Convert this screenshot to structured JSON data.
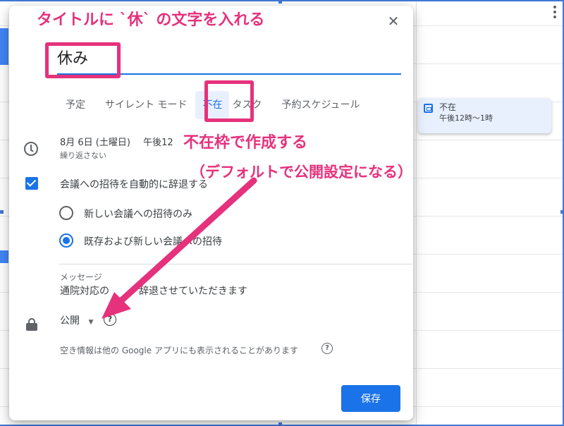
{
  "annotations": {
    "title_note": "タイトルに `休` の文字を入れる",
    "ooo_note_line1": "不在枠で作成する",
    "ooo_note_line2": "（デフォルトで公開設定になる）",
    "color": "#e6317c"
  },
  "dialog": {
    "title_value": "休み",
    "tabs": [
      {
        "label": "予定",
        "active": false
      },
      {
        "label": "サイレント モード",
        "active": false
      },
      {
        "label": "不在",
        "active": true
      },
      {
        "label": "タスク",
        "active": false
      },
      {
        "label": "予約スケジュール",
        "active": false
      }
    ],
    "datetime": {
      "date": "8月 6日 (土曜日)",
      "time": "午後12",
      "recurrence": "繰り返さない"
    },
    "auto_decline": {
      "label": "会議への招待を自動的に辞退する",
      "checked": true,
      "options": [
        {
          "label": "新しい会議への招待のみ",
          "selected": false
        },
        {
          "label": "既存および新しい会議への招待",
          "selected": true
        }
      ]
    },
    "message": {
      "label": "メッセージ",
      "value": "通院対応の　　、辞退させていただきます"
    },
    "visibility": {
      "value": "公開",
      "help_glyph": "?"
    },
    "availability_note": "空き情報は他の Google アプリにも表示されることがあります",
    "save_label": "保存",
    "close_glyph": "✕"
  },
  "calendar_event": {
    "title": "不在",
    "time": "午後12時〜1時"
  },
  "colors": {
    "accent": "#1a73e8",
    "tab_active_bg": "#e8f0fe",
    "event_bg": "#e8f0fe"
  }
}
